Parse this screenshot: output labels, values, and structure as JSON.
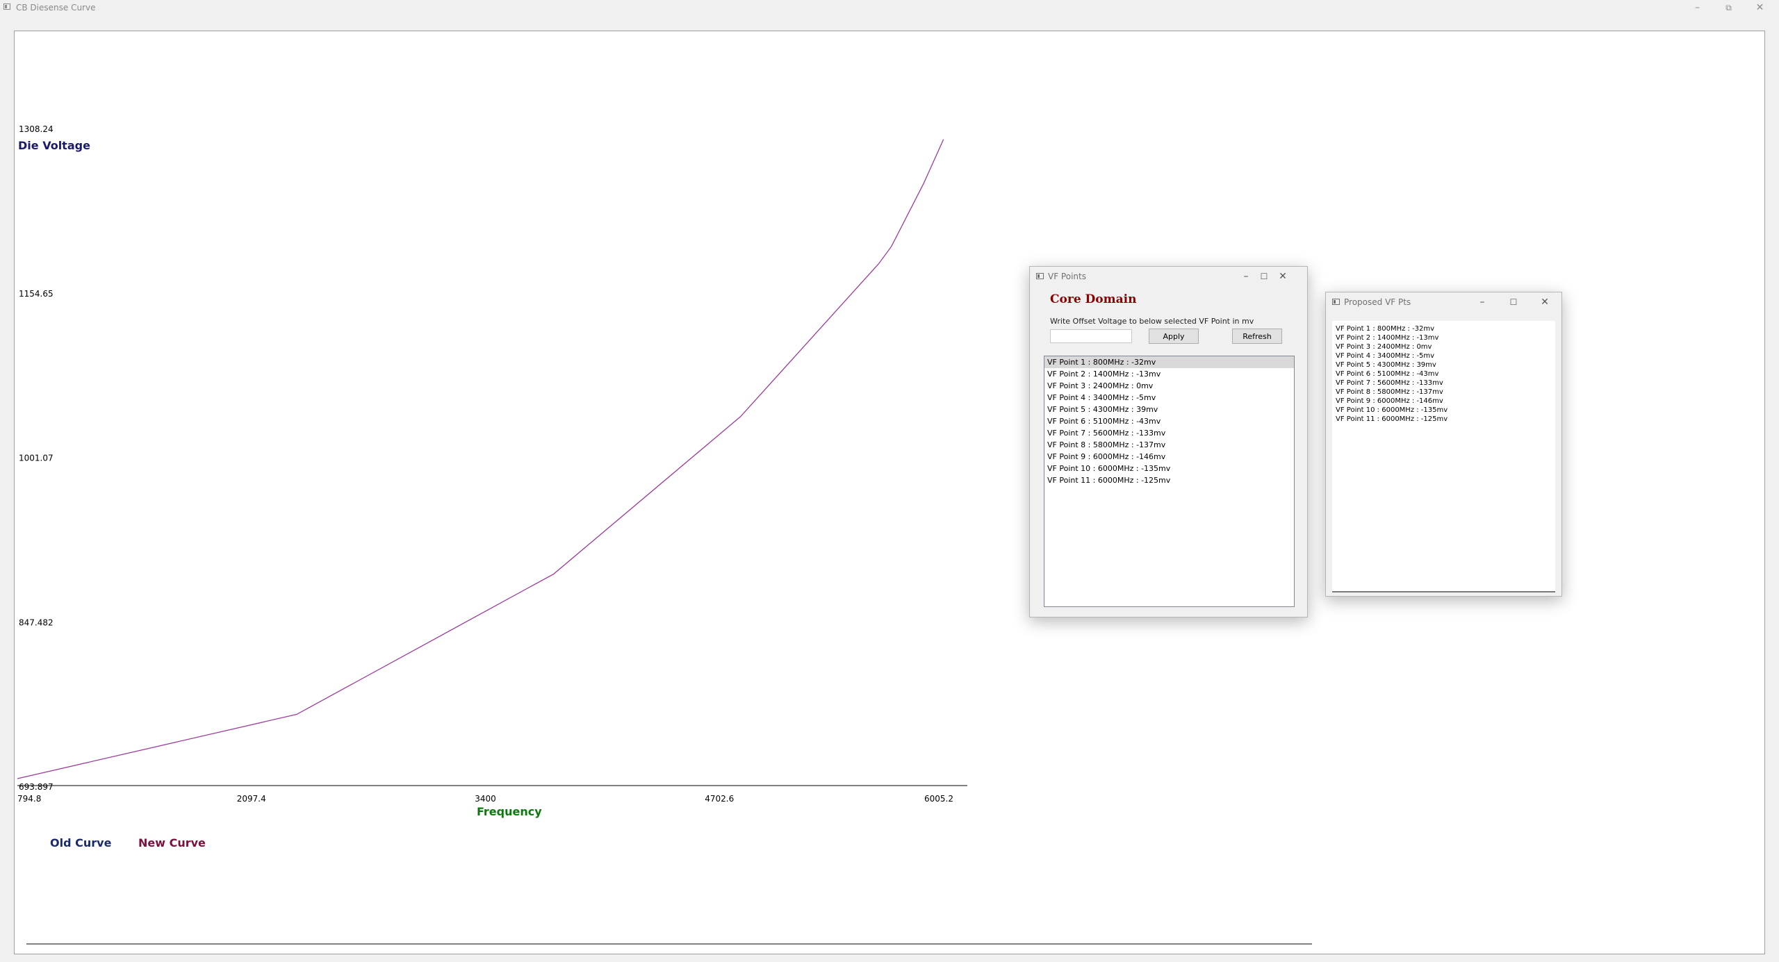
{
  "window": {
    "title": "CB Diesense Curve"
  },
  "colors": {
    "curve": "#9b3c9b",
    "old_curve_label": "#1a2a6a",
    "new_curve_label": "#7a1040",
    "frequency_label": "#0a7a0a",
    "die_voltage_label": "#1a1a6a",
    "core_domain": "#8b0000"
  },
  "chart_data": {
    "type": "line",
    "ylabel": "Die Voltage",
    "xlabel": "Frequency",
    "y_ticks": [
      "1308.24",
      "1154.65",
      "1001.07",
      "847.482",
      "693.897"
    ],
    "x_ticks": [
      "794.8",
      "2097.4",
      "3400",
      "4702.6",
      "6005.2"
    ],
    "xlim": [
      794.8,
      6005.2
    ],
    "ylim": [
      693.897,
      1308.24
    ],
    "legend": [
      "Old Curve",
      "New Curve"
    ],
    "series": [
      {
        "name": "New Curve",
        "x": [
          794.8,
          2350,
          3780,
          4820,
          5590,
          5660,
          5840,
          5950
        ],
        "y": [
          693.9,
          754,
          885,
          1032,
          1175,
          1191,
          1250,
          1291
        ]
      }
    ]
  },
  "vf_points_window": {
    "title": "VF Points",
    "domain": "Core Domain",
    "instruction": "Write Offset Voltage to below selected VF Point in mv",
    "offset_value": "",
    "apply_label": "Apply",
    "refresh_label": "Refresh",
    "items": [
      "VF Point 1 : 800MHz : -32mv",
      "VF Point 2 : 1400MHz : -13mv",
      "VF Point 3 : 2400MHz : 0mv",
      "VF Point 4 : 3400MHz : -5mv",
      "VF Point 5 : 4300MHz : 39mv",
      "VF Point 6 : 5100MHz : -43mv",
      "VF Point 7 : 5600MHz : -133mv",
      "VF Point 8 : 5800MHz : -137mv",
      "VF Point 9 : 6000MHz : -146mv",
      "VF Point 10 : 6000MHz : -135mv",
      "VF Point 11 : 6000MHz : -125mv"
    ]
  },
  "proposed_window": {
    "title": "Proposed VF Pts",
    "items": [
      "VF Point 1 : 800MHz : -32mv",
      "VF Point 2 : 1400MHz : -13mv",
      "VF Point 3 : 2400MHz : 0mv",
      "VF Point 4 : 3400MHz : -5mv",
      "VF Point 5 : 4300MHz : 39mv",
      "VF Point 6 : 5100MHz : -43mv",
      "VF Point 7 : 5600MHz : -133mv",
      "VF Point 8 : 5800MHz : -137mv",
      "VF Point 9 : 6000MHz : -146mv",
      "VF Point 10 : 6000MHz : -135mv",
      "VF Point 11 : 6000MHz : -125mv"
    ]
  }
}
